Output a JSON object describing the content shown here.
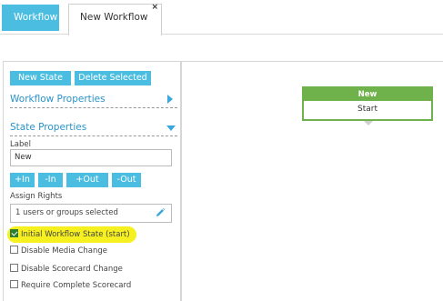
{
  "tabs": [
    {
      "label": "Workflow"
    },
    {
      "label": "New Workflow",
      "close": "×"
    }
  ],
  "toolbar": {
    "new_state": "New State",
    "delete_selected": "Delete Selected"
  },
  "sections": {
    "workflow_properties": "Workflow Properties",
    "state_properties": "State Properties"
  },
  "state": {
    "label_caption": "Label",
    "label_value": "New",
    "buttons": {
      "plus_in": "+In",
      "minus_in": "-In",
      "plus_out": "+Out",
      "minus_out": "-Out"
    },
    "assign_rights_caption": "Assign Rights",
    "assign_rights_value": "1 users or groups selected",
    "options": [
      {
        "label": "Initial Workflow State (start)",
        "checked": true
      },
      {
        "label": "Disable Media Change",
        "checked": false
      },
      {
        "label": "Disable Scorecard Change",
        "checked": false
      },
      {
        "label": "Require Complete Scorecard",
        "checked": false
      }
    ]
  },
  "canvas_node": {
    "title": "New",
    "subtitle": "Start",
    "color": "#6fb14b"
  },
  "colors": {
    "accent": "#4bbde0",
    "link": "#2a93c9",
    "highlight": "#f7f021"
  }
}
